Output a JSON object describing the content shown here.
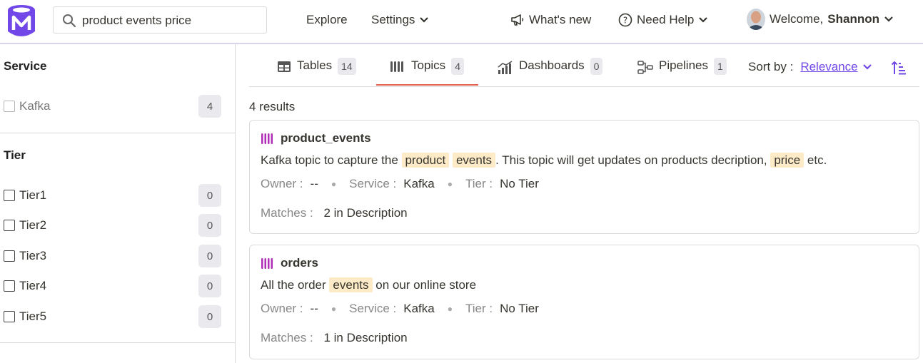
{
  "header": {
    "search_value": "product events price",
    "nav_explore": "Explore",
    "nav_settings": "Settings",
    "nav_whats_new": "What's new",
    "nav_need_help": "Need Help",
    "welcome_prefix": "Welcome,",
    "user_name": "Shannon"
  },
  "sidebar": {
    "service_title": "Service",
    "service_items": [
      {
        "label": "Kafka",
        "count": "4"
      }
    ],
    "tier_title": "Tier",
    "tier_items": [
      {
        "label": "Tier1",
        "count": "0"
      },
      {
        "label": "Tier2",
        "count": "0"
      },
      {
        "label": "Tier3",
        "count": "0"
      },
      {
        "label": "Tier4",
        "count": "0"
      },
      {
        "label": "Tier5",
        "count": "0"
      }
    ]
  },
  "tabs": [
    {
      "label": "Tables",
      "count": "14"
    },
    {
      "label": "Topics",
      "count": "4"
    },
    {
      "label": "Dashboards",
      "count": "0"
    },
    {
      "label": "Pipelines",
      "count": "1"
    }
  ],
  "sort": {
    "label": "Sort by :",
    "value": "Relevance"
  },
  "results_count": "4 results",
  "results": [
    {
      "name": "product_events",
      "desc_1": "Kafka topic to capture the",
      "hl_1": "product",
      "hl_2": "events",
      "desc_2": ". This topic will get updates on products decription,",
      "hl_3": "price",
      "desc_3": "etc.",
      "owner_label": "Owner :",
      "owner_value": "--",
      "service_label": "Service :",
      "service_value": "Kafka",
      "tier_label": "Tier :",
      "tier_value": "No Tier",
      "matches_label": "Matches :",
      "matches_value": "2 in Description"
    },
    {
      "name": "orders",
      "desc_1": "All the order",
      "hl_1": "events",
      "desc_2": "on our online store",
      "owner_label": "Owner :",
      "owner_value": "--",
      "service_label": "Service :",
      "service_value": "Kafka",
      "tier_label": "Tier :",
      "tier_value": "No Tier",
      "matches_label": "Matches :",
      "matches_value": "1 in Description"
    }
  ],
  "colors": {
    "brand": "#7147e8",
    "topic_icon": "#b12fb8",
    "highlight": "#fdebc8",
    "active_tab": "#e4604a"
  }
}
